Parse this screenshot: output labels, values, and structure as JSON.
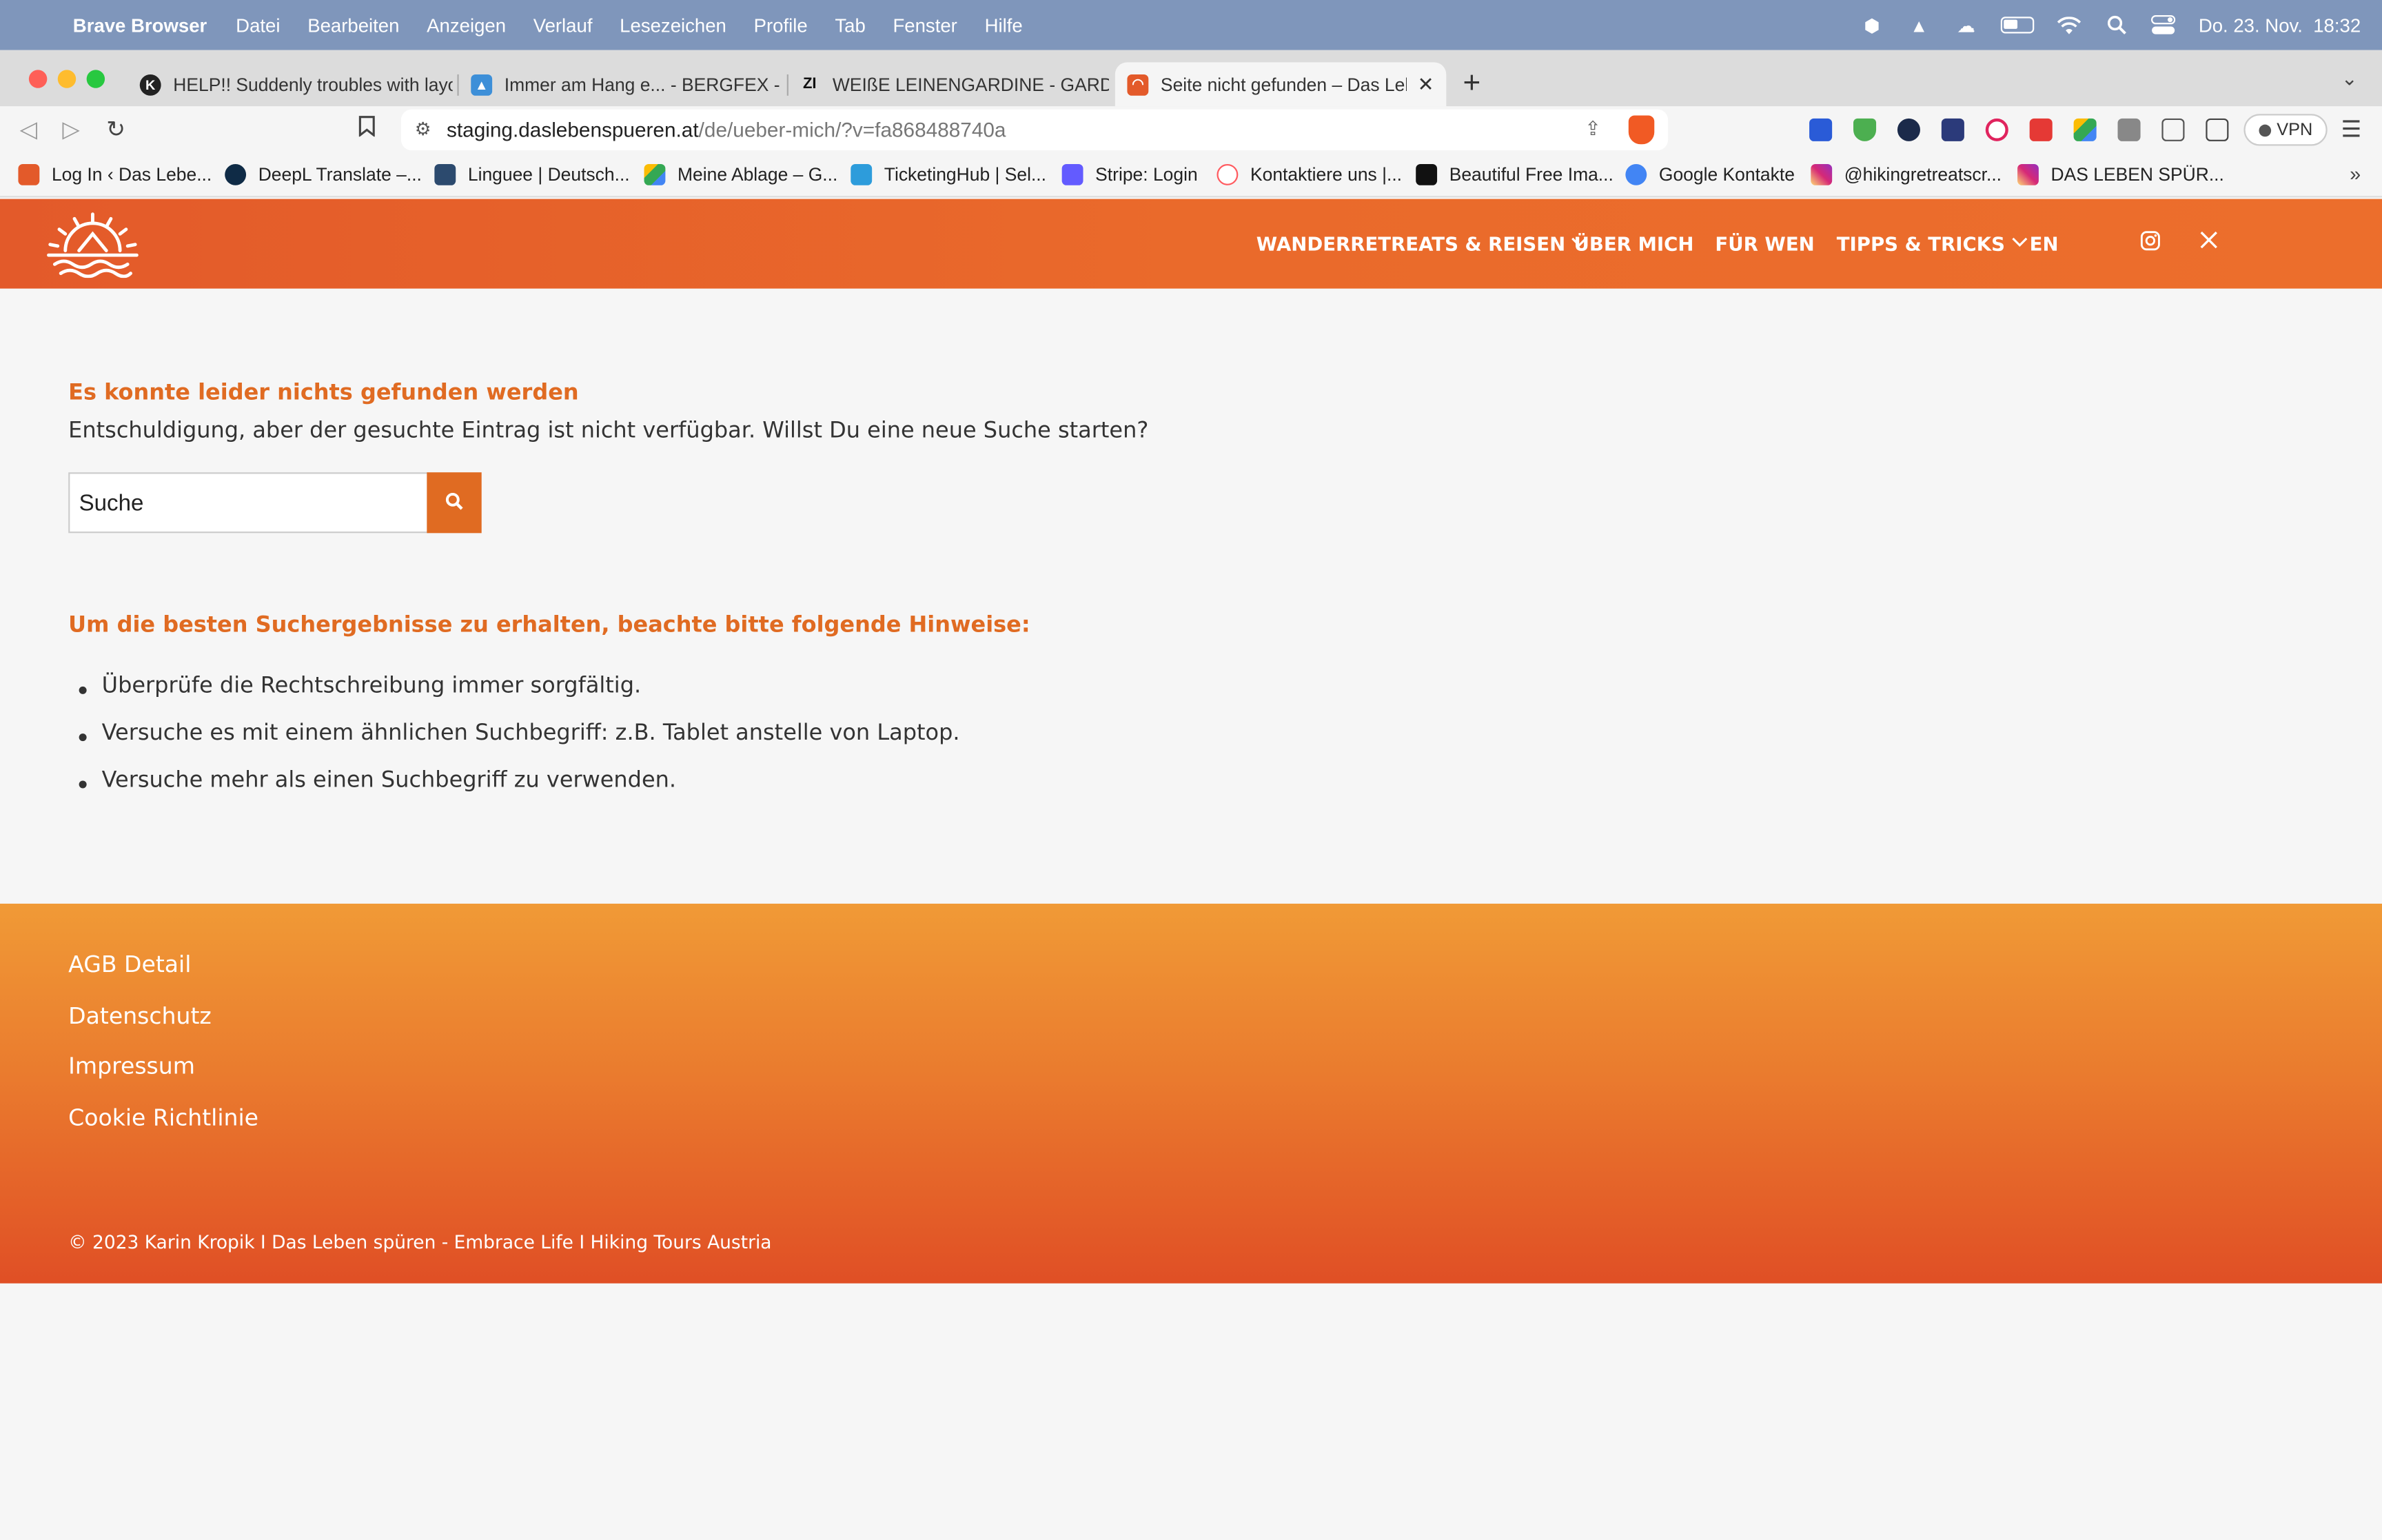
{
  "menubar": {
    "app_name": "Brave Browser",
    "items": [
      "Datei",
      "Bearbeiten",
      "Anzeigen",
      "Verlauf",
      "Lesezeichen",
      "Profile",
      "Tab",
      "Fenster",
      "Hilfe"
    ],
    "datetime": "Do. 23. Nov.  18:32",
    "status_icons": [
      "brave-vpn-icon",
      "drive-icon",
      "onedrive-icon",
      "battery-icon",
      "wifi-icon",
      "spotlight-search-icon",
      "control-center-icon"
    ]
  },
  "tabs": [
    {
      "title": "HELP!! Suddenly troubles with layo",
      "favicon": "kadence-icon"
    },
    {
      "title": "Immer am Hang e... - BERGFEX - W",
      "favicon": "bergfex-icon"
    },
    {
      "title": "WEIßE LEINENGARDINE - GARDINE",
      "favicon": "zara-icon"
    },
    {
      "title": "Seite nicht gefunden – Das Leb",
      "favicon": "das-leben-spueren-icon",
      "active": true
    }
  ],
  "toolbar": {
    "url_host": "staging.daslebenspueren.at",
    "url_path": "/de/ueber-mich/?v=fa868488740a",
    "vpn_label": "VPN"
  },
  "bookmarks": [
    {
      "label": "Log In ‹ Das Lebe...",
      "icon": "das-leben-spueren-icon"
    },
    {
      "label": "DeepL Translate –...",
      "icon": "deepl-icon"
    },
    {
      "label": "Linguee | Deutsch...",
      "icon": "linguee-icon"
    },
    {
      "label": "Meine Ablage – G...",
      "icon": "google-drive-icon"
    },
    {
      "label": "TicketingHub | Sel...",
      "icon": "ticketinghub-icon"
    },
    {
      "label": "Stripe: Login",
      "icon": "stripe-icon"
    },
    {
      "label": "Kontaktiere uns |...",
      "icon": "airbnb-icon"
    },
    {
      "label": "Beautiful Free Ima...",
      "icon": "unsplash-icon"
    },
    {
      "label": "Google Kontakte",
      "icon": "google-contacts-icon"
    },
    {
      "label": "@hikingretreatscr...",
      "icon": "instagram-icon"
    },
    {
      "label": "DAS LEBEN SPÜR...",
      "icon": "instagram-icon"
    }
  ],
  "site": {
    "nav": [
      "WANDERRETREATS & REISEN",
      "ÜBER MICH",
      "FÜR WEN",
      "TIPPS & TRICKS",
      "EN"
    ],
    "social": [
      "instagram-icon",
      "x-twitter-icon"
    ]
  },
  "main": {
    "heading": "Es konnte leider nichts gefunden werden",
    "text": "Entschuldigung, aber der gesuchte Eintrag ist nicht verfügbar. Willst Du eine neue Suche starten?",
    "search_placeholder": "Suche",
    "hints_heading": "Um die besten Suchergebnisse zu erhalten, beachte bitte folgende Hinweise:",
    "hints": [
      "Überprüfe die Rechtschreibung immer sorgfältig.",
      "Versuche es mit einem ähnlichen Suchbegriff: z.B. Tablet anstelle von Laptop.",
      "Versuche mehr als einen Suchbegriff zu verwenden."
    ]
  },
  "footer": {
    "links": [
      "AGB Detail",
      "Datenschutz",
      "Impressum",
      "Cookie Richtlinie"
    ],
    "copyright": "© 2023 Karin Kropik I Das Leben spüren - Embrace Life I Hiking Tours Austria"
  },
  "colors": {
    "menubar": "#7f96bb",
    "accent_orange": "#e06b22",
    "header_orange": "#ea6a2b",
    "footer_top": "#f09a36",
    "footer_bottom": "#e04f25"
  }
}
